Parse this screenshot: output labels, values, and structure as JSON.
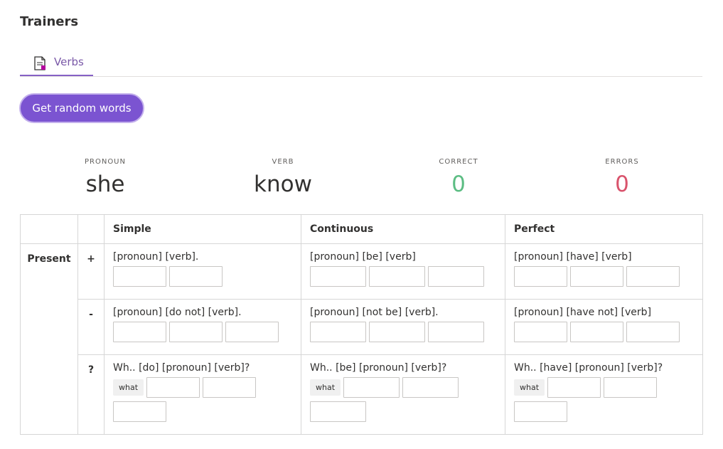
{
  "page": {
    "title": "Trainers"
  },
  "tabs": [
    {
      "label": "Verbs",
      "icon": "document-icon",
      "active": true
    }
  ],
  "actions": {
    "random_label": "Get random words"
  },
  "stats": {
    "pronoun": {
      "label": "PRONOUN",
      "value": "she"
    },
    "verb": {
      "label": "VERB",
      "value": "know"
    },
    "correct": {
      "label": "CORRECT",
      "value": "0",
      "color": "#5cbd83"
    },
    "errors": {
      "label": "ERRORS",
      "value": "0",
      "color": "#d9536c"
    }
  },
  "table": {
    "headers": [
      "Simple",
      "Continuous",
      "Perfect"
    ],
    "tense": "Present",
    "signs": [
      "+",
      "-",
      "?"
    ],
    "patterns": {
      "positive": [
        "[pronoun] [verb].",
        "[pronoun] [be] [verb]",
        "[pronoun] [have] [verb]"
      ],
      "negative": [
        "[pronoun] [do not] [verb].",
        "[pronoun] [not be] [verb].",
        "[pronoun] [have not] [verb]"
      ],
      "question": [
        "Wh.. [do] [pronoun] [verb]?",
        "Wh.. [be] [pronoun] [verb]?",
        "Wh.. [have] [pronoun] [verb]?"
      ]
    },
    "question_word": "what"
  },
  "colors": {
    "accent": "#7b54d1",
    "tab_text": "#7a59a8"
  }
}
